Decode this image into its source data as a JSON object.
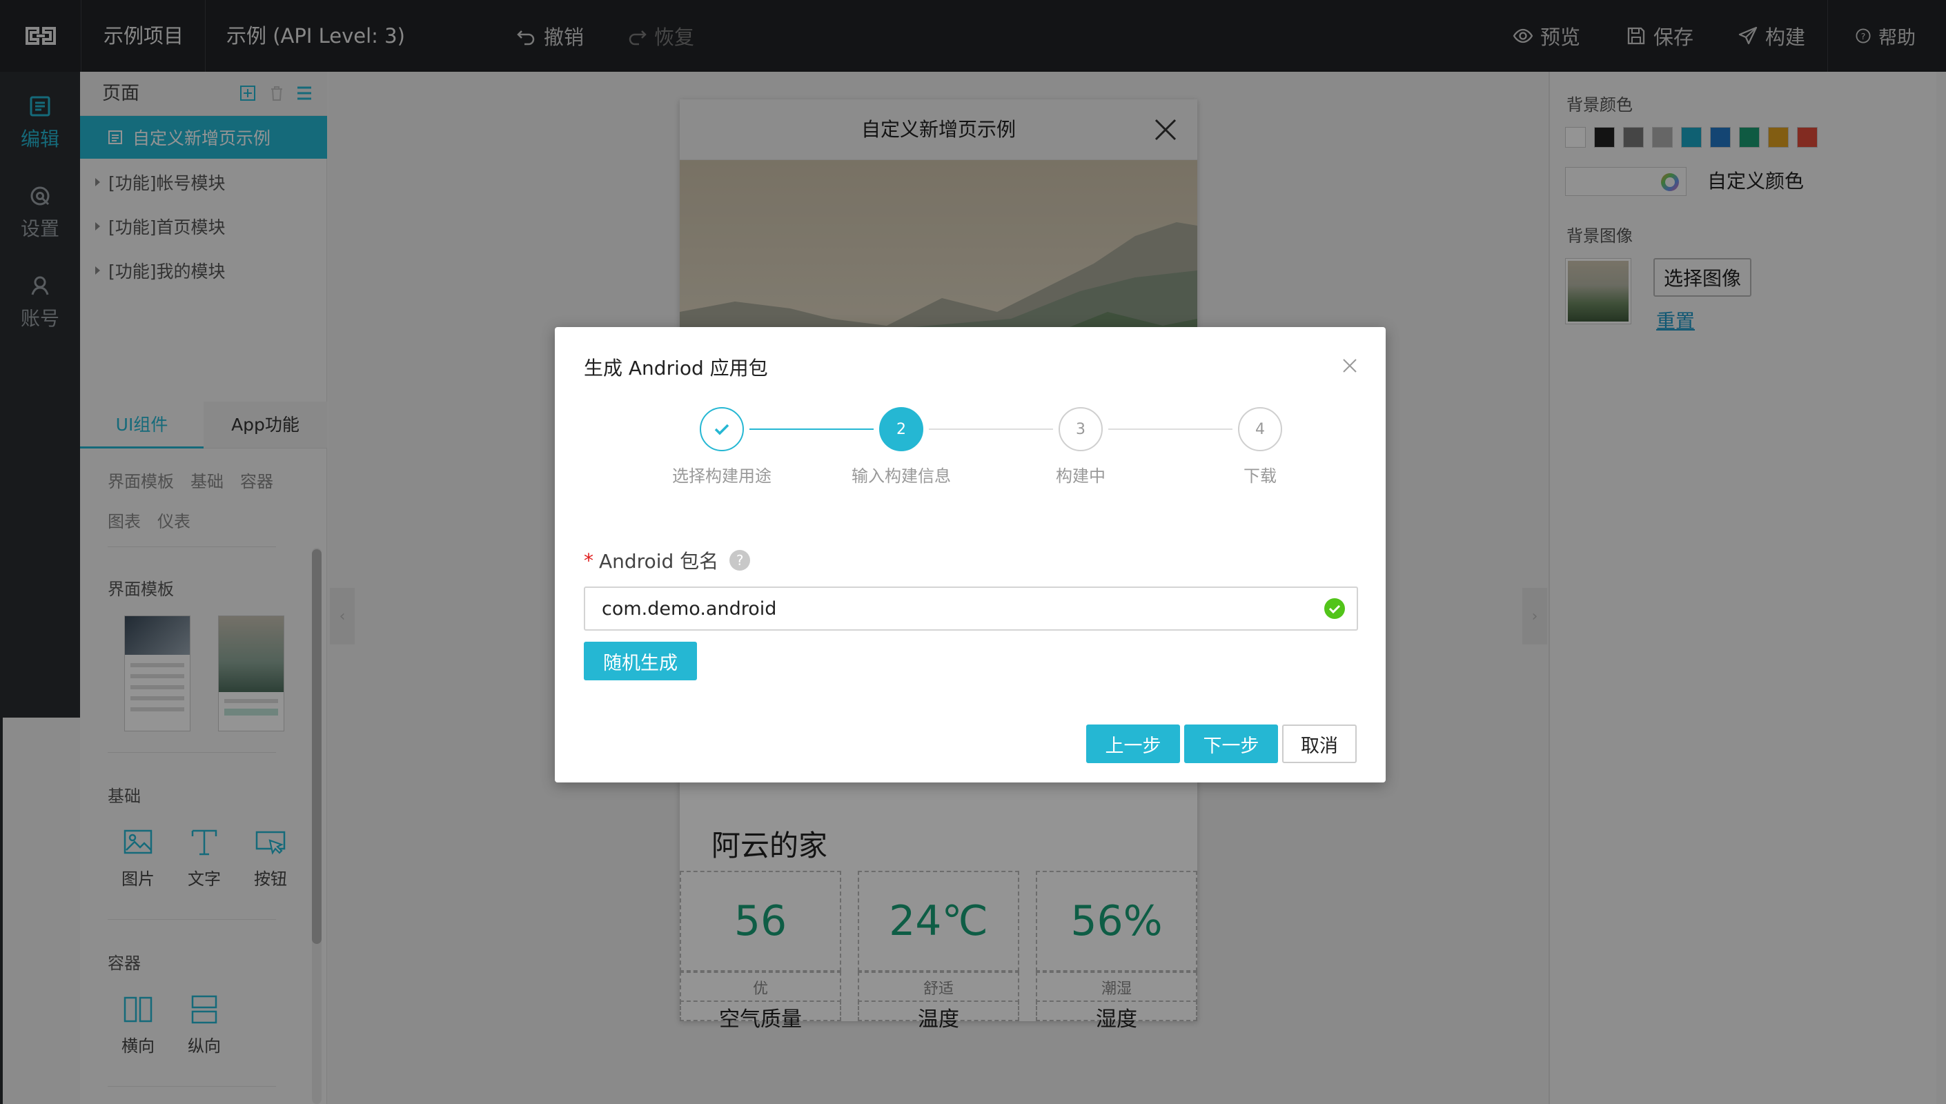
{
  "topbar": {
    "project_name": "示例项目",
    "app_name": "示例 (API Level: 3)",
    "undo_label": "撤销",
    "redo_label": "恢复",
    "preview_label": "预览",
    "save_label": "保存",
    "build_label": "构建",
    "help_label": "帮助"
  },
  "leftnav": {
    "items": [
      {
        "label": "编辑",
        "icon": "edit-icon"
      },
      {
        "label": "设置",
        "icon": "settings-icon"
      },
      {
        "label": "账号",
        "icon": "account-icon"
      }
    ]
  },
  "pages": {
    "title": "页面",
    "selected": "自定义新增页示例",
    "items": [
      "[功能]帐号模块",
      "[功能]首页模块",
      "[功能]我的模块"
    ]
  },
  "components": {
    "tabs": [
      "UI组件",
      "App功能"
    ],
    "categories_row1": [
      "界面模板",
      "基础",
      "容器"
    ],
    "categories_row2": [
      "图表",
      "仪表"
    ],
    "template_title": "界面模板",
    "basic_title": "基础",
    "basic_items": [
      "图片",
      "文字",
      "按钮"
    ],
    "container_title": "容器",
    "container_items": [
      "横向",
      "纵向"
    ]
  },
  "phone": {
    "title": "自定义新增页示例",
    "family_name": "阿云的家",
    "cells": [
      {
        "value": "56",
        "sub": "优",
        "label": "空气质量"
      },
      {
        "value": "24℃",
        "sub": "舒适",
        "label": "温度"
      },
      {
        "value": "56%",
        "sub": "潮湿",
        "label": "湿度"
      }
    ]
  },
  "rightpanel": {
    "bg_color_label": "背景颜色",
    "swatches": [
      "#ffffff",
      "#222222",
      "#777777",
      "#b0b0b0",
      "#1aa6c4",
      "#2478c7",
      "#1a9b72",
      "#e0a020",
      "#e04b3a"
    ],
    "custom_color_label": "自定义颜色",
    "bg_image_label": "背景图像",
    "select_image_label": "选择图像",
    "reset_label": "重置"
  },
  "modal": {
    "title": "生成 Andriod 应用包",
    "steps": [
      {
        "num": "1",
        "label": "选择构建用途",
        "state": "done"
      },
      {
        "num": "2",
        "label": "输入构建信息",
        "state": "current"
      },
      {
        "num": "3",
        "label": "构建中",
        "state": "pending"
      },
      {
        "num": "4",
        "label": "下载",
        "state": "pending"
      }
    ],
    "field_required_mark": "*",
    "field_label": "Android 包名",
    "field_help": "?",
    "field_value": "com.demo.android",
    "random_label": "随机生成",
    "prev_label": "上一步",
    "next_label": "下一步",
    "cancel_label": "取消"
  },
  "colors": {
    "accent": "#25b7d3",
    "topbar_bg": "#212326",
    "success": "#52c41a"
  }
}
